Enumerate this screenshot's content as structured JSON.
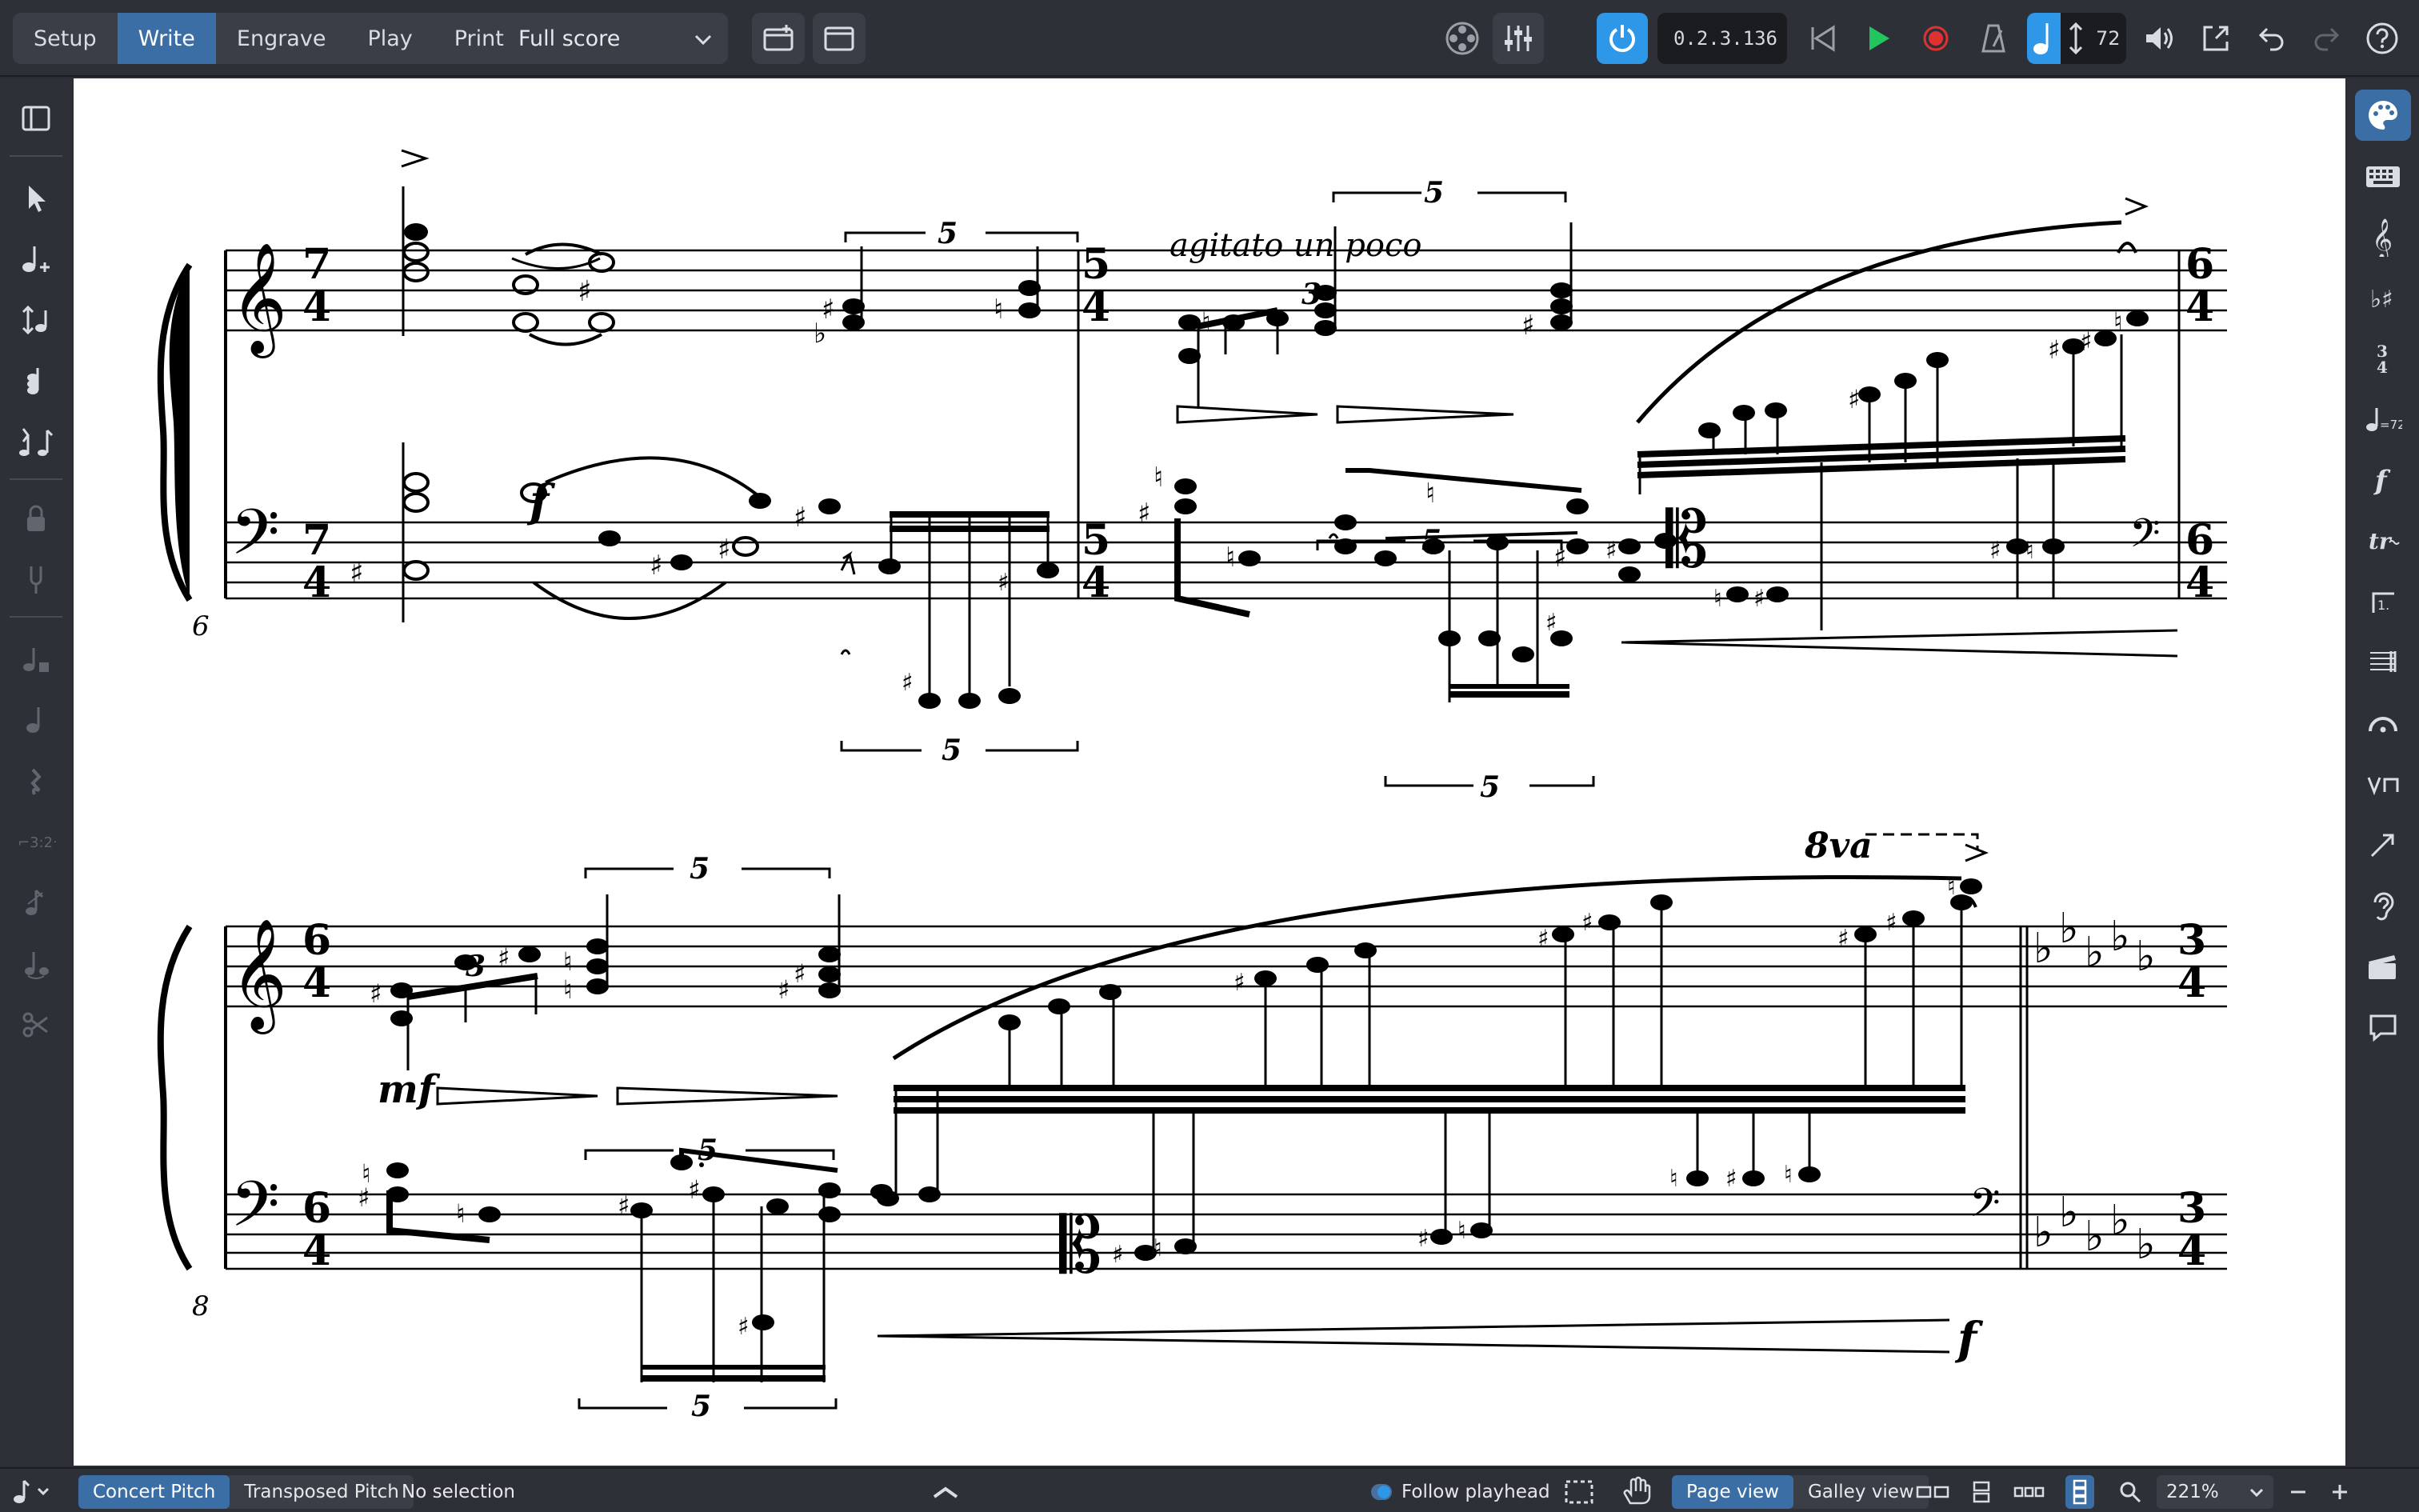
{
  "toolbar": {
    "modes": [
      "Setup",
      "Write",
      "Engrave",
      "Play",
      "Print"
    ],
    "active_mode": "Write",
    "layout_selector": "Full score",
    "timecode": "0.2.3.136",
    "tempo": "72"
  },
  "score": {
    "expression_agitato": "agitato un poco",
    "bar_number_system1": "6",
    "bar_number_system2": "8",
    "tuplet_3": "3",
    "tuplet_5": "5",
    "dynamic_f": "f",
    "dynamic_mf": "mf",
    "octave_line": "8va",
    "time_sig": {
      "t7": "7",
      "t5": "5",
      "t6": "6",
      "t4": "4",
      "t3": "3"
    }
  },
  "statusbar": {
    "concert_pitch": "Concert Pitch",
    "transposed_pitch": "Transposed Pitch",
    "selection": "No selection",
    "follow_playhead": "Follow playhead",
    "page_view": "Page view",
    "galley_view": "Galley view",
    "zoom": "221%"
  },
  "colors": {
    "accent": "#3b6ea5",
    "power": "#2f97e8",
    "play": "#22c55e",
    "record": "#e03131",
    "panel": "#2d3036"
  }
}
